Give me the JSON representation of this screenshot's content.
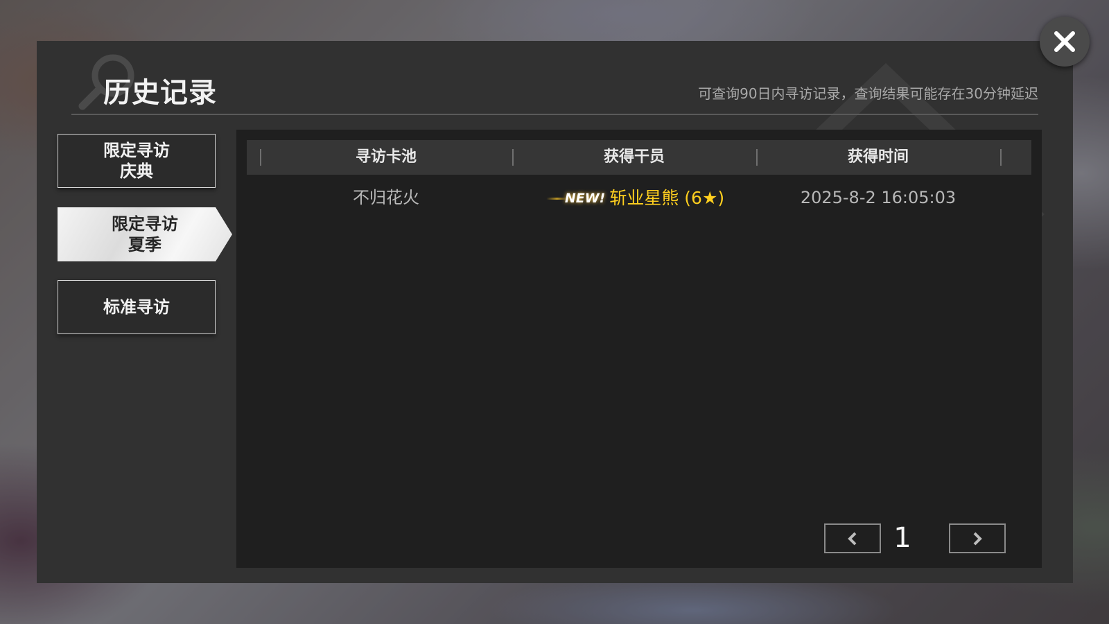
{
  "header": {
    "title": "历史记录",
    "notice": "可查询90日内寻访记录，查询结果可能存在30分钟延迟"
  },
  "tabs": [
    {
      "label": "限定寻访\n庆典",
      "active": false
    },
    {
      "label": "限定寻访\n夏季",
      "active": true
    },
    {
      "label": "标准寻访",
      "active": false
    }
  ],
  "table": {
    "columns": [
      "寻访卡池",
      "获得干员",
      "获得时间"
    ],
    "rows": [
      {
        "pool": "不归花火",
        "new_badge": "NEW!",
        "operator": "斩业星熊 (6★)",
        "time": "2025-8-2 16:05:03"
      }
    ]
  },
  "pagination": {
    "current_page": "1",
    "prev_icon": "chevron-left-icon",
    "next_icon": "chevron-right-icon"
  },
  "colors": {
    "panel_bg": "#313131",
    "content_bg": "#1f1f1f",
    "header_bg": "#363636",
    "operator_highlight": "#ffcf1f"
  },
  "close_icon": "close-icon"
}
